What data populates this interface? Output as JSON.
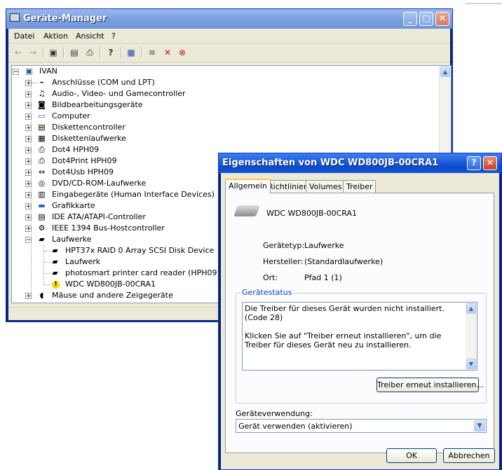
{
  "device_manager": {
    "title": "Geräte-Manager",
    "menu": [
      "Datei",
      "Aktion",
      "Ansicht",
      "?"
    ],
    "toolbar_icons": [
      "back-arrow-icon",
      "forward-arrow-icon",
      "show-hide-tree-icon",
      "properties-icon",
      "print-icon",
      "help-icon",
      "scan-hardware-icon",
      "update-driver-icon",
      "disable-device-icon",
      "uninstall-device-icon"
    ],
    "tree": {
      "root": "IVAN",
      "categories": [
        "Anschlüsse (COM und LPT)",
        "Audio-, Video- und Gamecontroller",
        "Bildbearbeitungsgeräte",
        "Computer",
        "Diskettencontroller",
        "Diskettenlaufwerke",
        "Dot4 HPH09",
        "Dot4Print HPH09",
        "Dot4Usb HPH09",
        "DVD/CD-ROM-Laufwerke",
        "Eingabegeräte (Human Interface Devices)",
        "Grafikkarte",
        "IDE ATA/ATAPI-Controller",
        "IEEE 1394 Bus-Hostcontroller",
        "Laufwerke"
      ],
      "laufwerke_children": [
        "HPT37x RAID 0 Array SCSI Disk Device",
        "Laufwerk",
        "photosmart printer card reader (HPH09)",
        "WDC WD800JB-00CRA1"
      ],
      "after": "Mäuse und andere Zeigegeräte"
    }
  },
  "dialog": {
    "title": "Eigenschaften von WDC WD800JB-00CRA1",
    "tabs": [
      "Allgemein",
      "Richtlinien",
      "Volumes",
      "Treiber"
    ],
    "device_name": "WDC WD800JB-00CRA1",
    "props": {
      "type_label": "Gerätetyp:",
      "type_value": "Laufwerke",
      "mfr_label": "Hersteller:",
      "mfr_value": "(Standardlaufwerke)",
      "loc_label": "Ort:",
      "loc_value": "Pfad 1 (1)"
    },
    "status_group_label": "Gerätestatus",
    "status_text": "Die Treiber für dieses Gerät wurden nicht installiert. (Code 28)\n\nKlicken Sie auf \"Treiber erneut installieren\", um die Treiber für dieses Gerät neu zu installieren.",
    "reinstall_button": "Treiber erneut installieren...",
    "usage_label": "Geräteverwendung:",
    "usage_value": "Gerät verwenden (aktivieren)",
    "ok": "OK",
    "cancel": "Abbrechen",
    "help_glyph": "?",
    "close_glyph": "✕"
  },
  "colors": {
    "xp_title": "#0b4ccf",
    "face": "#ece9d8",
    "groupbox_label": "#0046d5"
  }
}
